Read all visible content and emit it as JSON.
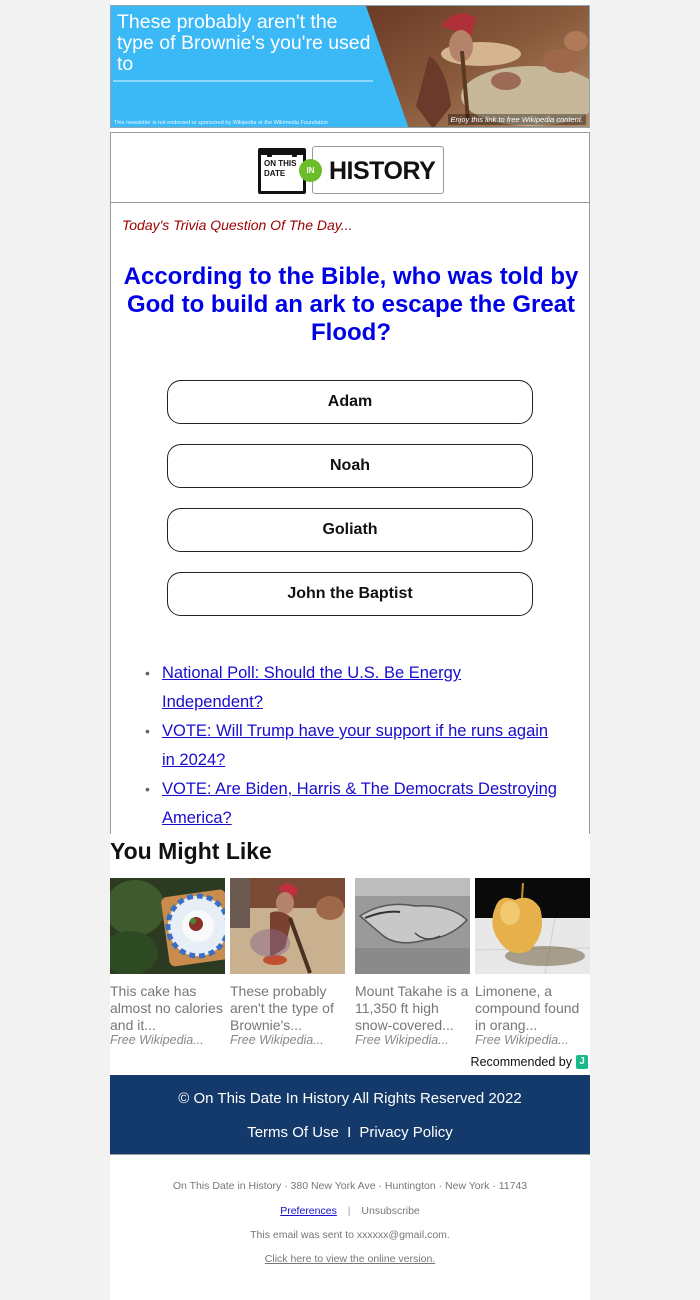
{
  "banner": {
    "title": "These probably aren't the type of Brownie's you're used to",
    "disclaimer": "This newsletter is not endorsed or sponsored by Wikipedia or the Wikimedia Foundation",
    "caption": "Enjoy this link to free Wikipedia content.",
    "bg_color": "#3ab9f6"
  },
  "logo": {
    "calendar_text": "ON THIS DATE",
    "in_badge": "IN",
    "history_text": "HISTORY",
    "badge_color": "#6cbd2b"
  },
  "trivia": {
    "label": "Today's Trivia Question Of The Day...",
    "question": "According to the Bible, who was told by God to build an ark to escape the Great Flood?",
    "answers": [
      "Adam",
      "Noah",
      "Goliath",
      "John the Baptist"
    ],
    "question_color": "#0000e6",
    "label_color": "#9b0000"
  },
  "links": [
    "National Poll: Should the U.S. Be Energy Independent?",
    "VOTE: Will Trump have your support if he runs again in 2024?",
    "VOTE: Are Biden, Harris & The Democrats Destroying America?"
  ],
  "you_might_like": {
    "title": "You Might Like",
    "cards": [
      {
        "title": "This cake has almost no calories and it...",
        "source": "Free Wikipedia..."
      },
      {
        "title": "These probably aren't the type of Brownie's...",
        "source": "Free Wikipedia..."
      },
      {
        "title": "Mount Takahe is a 11,350 ft high snow-covered...",
        "source": "Free Wikipedia..."
      },
      {
        "title": "Limonene, a compound found in orang...",
        "source": "Free Wikipedia..."
      }
    ],
    "recommended_by": "Recommended by",
    "recommended_logo": "J"
  },
  "footer": {
    "copyright": "© On This Date In History All Rights Reserved 2022",
    "terms": "Terms Of Use",
    "divider": "I",
    "privacy": "Privacy Policy",
    "bg_color": "#14396b",
    "address": "On This Date in History · 380 New York Ave · Huntington · New York · 11743",
    "preferences": "Preferences",
    "separator": "|",
    "unsubscribe": "Unsubscribe",
    "sent_to": "This email was sent to xxxxxx@gmail.com.",
    "online_version": "Click here to view the online version."
  }
}
